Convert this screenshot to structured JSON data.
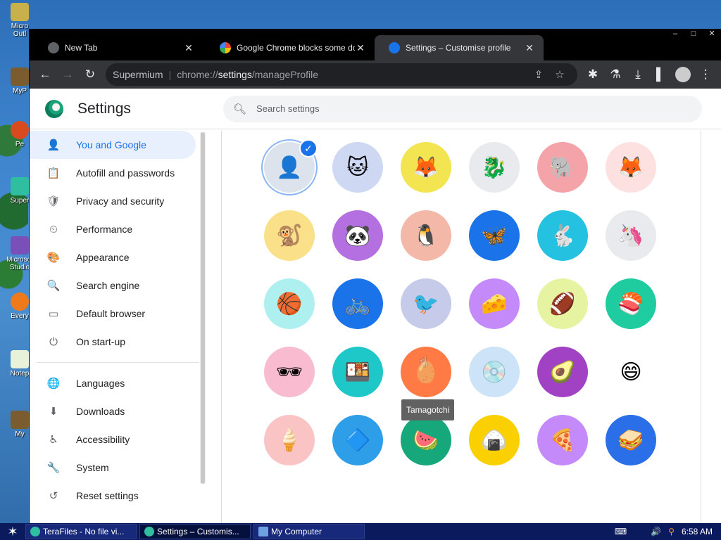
{
  "desktop": {
    "icons": [
      "Micro Outl",
      "MyP",
      "Pe",
      "Super",
      "Microsof Studio",
      "Every",
      "Notep",
      "My"
    ]
  },
  "browser": {
    "tabs": [
      {
        "title": "New Tab",
        "favicon_color": "#5f6368"
      },
      {
        "title": "Google Chrome blocks some downlo",
        "favicon_color": "#ffffff"
      },
      {
        "title": "Settings – Customise profile",
        "favicon_color": "#1a73e8"
      }
    ],
    "window_controls": [
      "–",
      "□",
      "✕"
    ],
    "omnibox": {
      "site": "Supermium",
      "url_prefix": "chrome://",
      "url_host": "settings",
      "url_path": "/manageProfile"
    }
  },
  "settings": {
    "title": "Settings",
    "search_placeholder": "Search settings",
    "nav": [
      {
        "label": "You and Google",
        "icon": "person-icon",
        "glyph": "👤",
        "active": true
      },
      {
        "label": "Autofill and passwords",
        "icon": "clipboard-icon",
        "glyph": "📋"
      },
      {
        "label": "Privacy and security",
        "icon": "shield-icon",
        "glyph": "🛡"
      },
      {
        "label": "Performance",
        "icon": "speedometer-icon",
        "glyph": "⏲"
      },
      {
        "label": "Appearance",
        "icon": "palette-icon",
        "glyph": "🎨"
      },
      {
        "label": "Search engine",
        "icon": "search-icon",
        "glyph": "🔍"
      },
      {
        "label": "Default browser",
        "icon": "browser-icon",
        "glyph": "▭"
      },
      {
        "label": "On start-up",
        "icon": "power-icon",
        "glyph": "⏻"
      }
    ],
    "nav_advanced": [
      {
        "label": "Languages",
        "icon": "globe-icon",
        "glyph": "🌐"
      },
      {
        "label": "Downloads",
        "icon": "download-icon",
        "glyph": "⬇"
      },
      {
        "label": "Accessibility",
        "icon": "accessibility-icon",
        "glyph": "♿"
      },
      {
        "label": "System",
        "icon": "wrench-icon",
        "glyph": "🔧"
      },
      {
        "label": "Reset settings",
        "icon": "reset-icon",
        "glyph": "↺"
      }
    ],
    "avatars": [
      {
        "name": "generic-avatar",
        "bg": "#dde3ec",
        "glyph": "👤",
        "selected": true
      },
      {
        "name": "cat-avatar",
        "bg": "#cfd8f2",
        "glyph": "🐱"
      },
      {
        "name": "fox-avatar",
        "bg": "#f3e552",
        "glyph": "🦊"
      },
      {
        "name": "dragon-avatar",
        "bg": "#e8eaed",
        "glyph": "🐉"
      },
      {
        "name": "elephant-avatar",
        "bg": "#f4a3a8",
        "glyph": "🐘"
      },
      {
        "name": "fox2-avatar",
        "bg": "#fde1e1",
        "glyph": "🦊"
      },
      {
        "name": "monkey-avatar",
        "bg": "#fbe08a",
        "glyph": "🐒"
      },
      {
        "name": "panda-avatar",
        "bg": "#b46fe0",
        "glyph": "🐼"
      },
      {
        "name": "penguin-avatar",
        "bg": "#f4b8a8",
        "glyph": "🐧"
      },
      {
        "name": "butterfly-avatar",
        "bg": "#1a73e8",
        "glyph": "🦋"
      },
      {
        "name": "rabbit-avatar",
        "bg": "#24c1e0",
        "glyph": "🐇"
      },
      {
        "name": "unicorn-avatar",
        "bg": "#e8eaed",
        "glyph": "🦄"
      },
      {
        "name": "basketball-avatar",
        "bg": "#aef0f0",
        "glyph": "🏀"
      },
      {
        "name": "bike-avatar",
        "bg": "#1a73e8",
        "glyph": "🚲"
      },
      {
        "name": "bird-avatar",
        "bg": "#c7cbea",
        "glyph": "🐦"
      },
      {
        "name": "cheese-avatar",
        "bg": "#c58af9",
        "glyph": "🧀"
      },
      {
        "name": "football-avatar",
        "bg": "#e6f3a0",
        "glyph": "🏈"
      },
      {
        "name": "sushi-plate-avatar",
        "bg": "#1ecc9f",
        "glyph": "🍣"
      },
      {
        "name": "sunglasses-avatar",
        "bg": "#f8bbd0",
        "glyph": "🕶"
      },
      {
        "name": "sushi-avatar",
        "bg": "#1ec8c8",
        "glyph": "🍱"
      },
      {
        "name": "tamagotchi-avatar",
        "bg": "#ff7a45",
        "glyph": "🥚"
      },
      {
        "name": "vinyl-avatar",
        "bg": "#cde3f7",
        "glyph": "💿"
      },
      {
        "name": "avocado-avatar",
        "bg": "#a142c4",
        "glyph": "🥑"
      },
      {
        "name": "smile-avatar",
        "bg": "#ffffff",
        "glyph": "😄"
      },
      {
        "name": "icecream-avatar",
        "bg": "#fbc4c4",
        "glyph": "🍦"
      },
      {
        "name": "origami-avatar",
        "bg": "#2e9ee8",
        "glyph": "🔷"
      },
      {
        "name": "watermelon-avatar",
        "bg": "#16a77a",
        "glyph": "🍉"
      },
      {
        "name": "onigiri-avatar",
        "bg": "#fbd000",
        "glyph": "🍙"
      },
      {
        "name": "pizza-avatar",
        "bg": "#c58af9",
        "glyph": "🍕"
      },
      {
        "name": "sandwich-avatar",
        "bg": "#2a6ee8",
        "glyph": "🥪"
      }
    ],
    "tooltip": "Tamagotchi"
  },
  "taskbar": {
    "tasks": [
      {
        "label": "TeraFiles - No file vi...",
        "active": false
      },
      {
        "label": "Settings – Customis...",
        "active": true
      },
      {
        "label": "My Computer",
        "active": false
      }
    ],
    "clock": "6:58 AM"
  }
}
